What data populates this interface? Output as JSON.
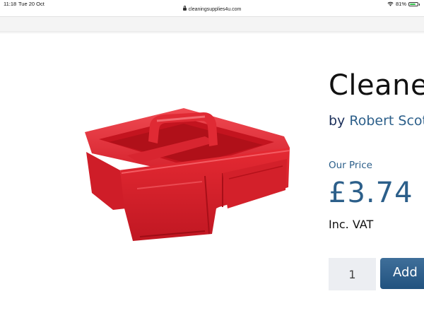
{
  "status_bar": {
    "time": "11:18",
    "date": "Tue 20 Oct",
    "battery": "81%",
    "battery_level": 0.81
  },
  "browser": {
    "url": "cleaningsupplies4u.com"
  },
  "product": {
    "title": "Cleaner",
    "by_prefix": "by",
    "brand": "Robert Scot",
    "price_label": "Our Price",
    "price": "£3.74",
    "vat_note": "Inc. VAT",
    "quantity": "1",
    "add_button_label": "Add",
    "image_color": "#d8202c"
  },
  "colors": {
    "accent_blue": "#2c5f8a",
    "button_blue": "#2b5c88"
  }
}
